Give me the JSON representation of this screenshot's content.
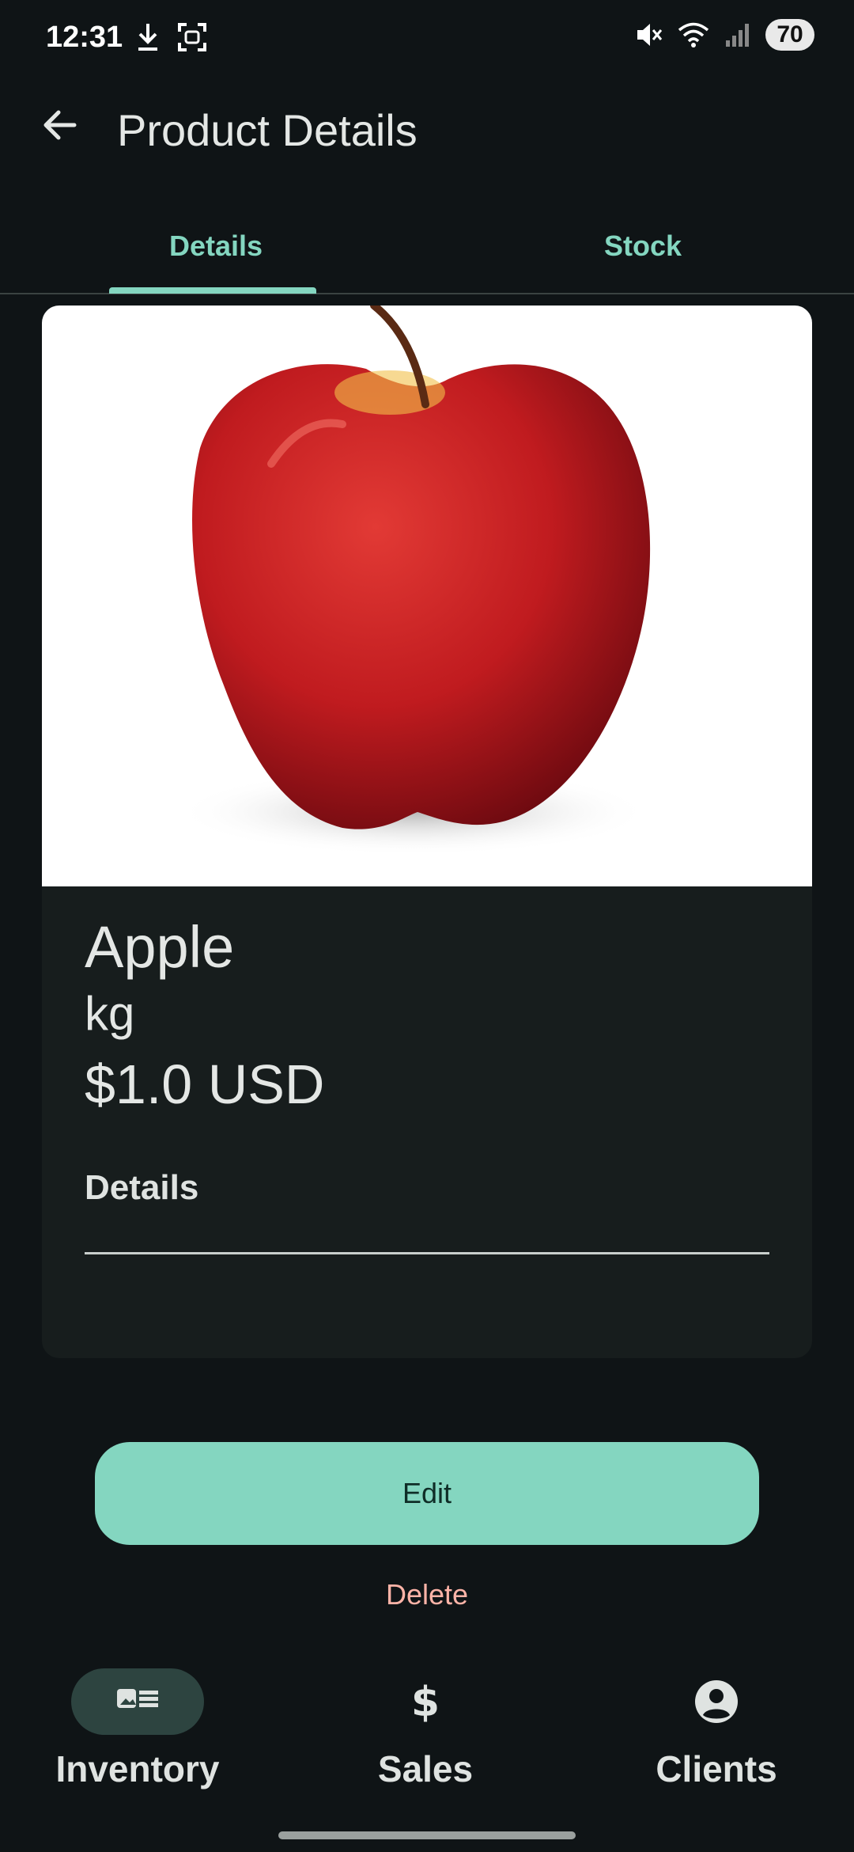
{
  "status_bar": {
    "time": "12:31",
    "battery": "70",
    "left_icons": [
      "download-icon",
      "screenshot-icon"
    ],
    "right_icons": [
      "mute-icon",
      "wifi-icon",
      "signal-icon"
    ]
  },
  "app_bar": {
    "title": "Product Details",
    "back_icon": "arrow-back-icon"
  },
  "tabs": [
    {
      "label": "Details",
      "selected": true
    },
    {
      "label": "Stock",
      "selected": false
    }
  ],
  "product": {
    "name": "Apple",
    "unit": "kg",
    "price": "$1.0 USD",
    "details_label": "Details",
    "details_value": ""
  },
  "actions": {
    "edit_label": "Edit",
    "delete_label": "Delete"
  },
  "bottom_nav": [
    {
      "label": "Inventory",
      "icon": "inventory-icon",
      "selected": true
    },
    {
      "label": "Sales",
      "icon": "dollar-icon",
      "selected": false
    },
    {
      "label": "Clients",
      "icon": "account-circle-icon",
      "selected": false
    }
  ],
  "colors": {
    "background": "#0f1416",
    "accent": "#84d6c0",
    "delete": "#ffb4a8",
    "card": "#171d1d"
  }
}
